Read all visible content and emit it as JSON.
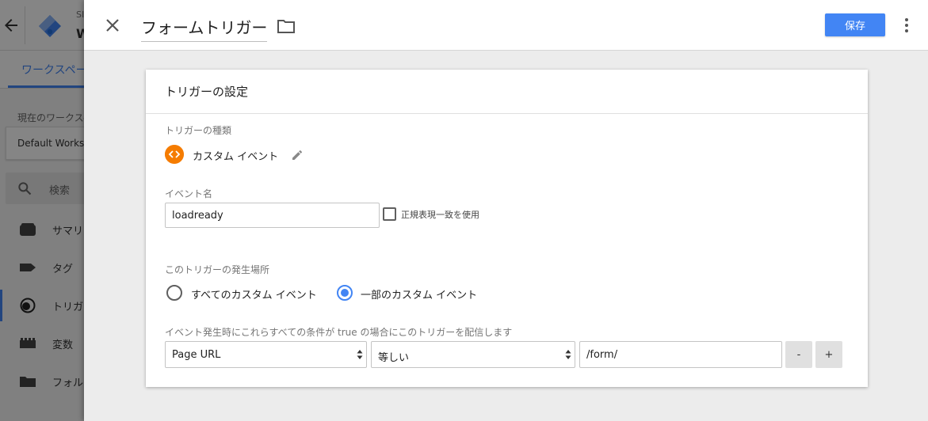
{
  "background": {
    "account_small": "SI",
    "account_big": "W",
    "workspace_tab": "ワークスペース",
    "current_workspace_label": "現在のワークスペース",
    "workspace_name": "Default Workspace",
    "search_placeholder": "検索",
    "nav": [
      {
        "label": "サマリー",
        "icon": "overview-icon"
      },
      {
        "label": "タグ",
        "icon": "tag-icon"
      },
      {
        "label": "トリガー",
        "icon": "trigger-icon"
      },
      {
        "label": "変数",
        "icon": "variable-icon"
      },
      {
        "label": "フォルダ",
        "icon": "folder-icon"
      }
    ]
  },
  "panel": {
    "title": "フォームトリガー",
    "save_label": "保存"
  },
  "card": {
    "title": "トリガーの設定",
    "type_label": "トリガーの種類",
    "type_name": "カスタム イベント",
    "event_name_label": "イベント名",
    "event_name_value": "loadready",
    "regex_label": "正規表現一致を使用",
    "fires_on_label": "このトリガーの発生場所",
    "radio_all": "すべてのカスタム イベント",
    "radio_some": "一部のカスタム イベント",
    "condition_label": "イベント発生時にこれらすべての条件が true の場合にこのトリガーを配信します",
    "condition": {
      "variable": "Page URL",
      "operator": "等しい",
      "value": "/form/"
    },
    "remove_label": "-",
    "add_label": "+"
  },
  "colors": {
    "accent": "#4285f4",
    "custom_event": "#f57c00"
  }
}
